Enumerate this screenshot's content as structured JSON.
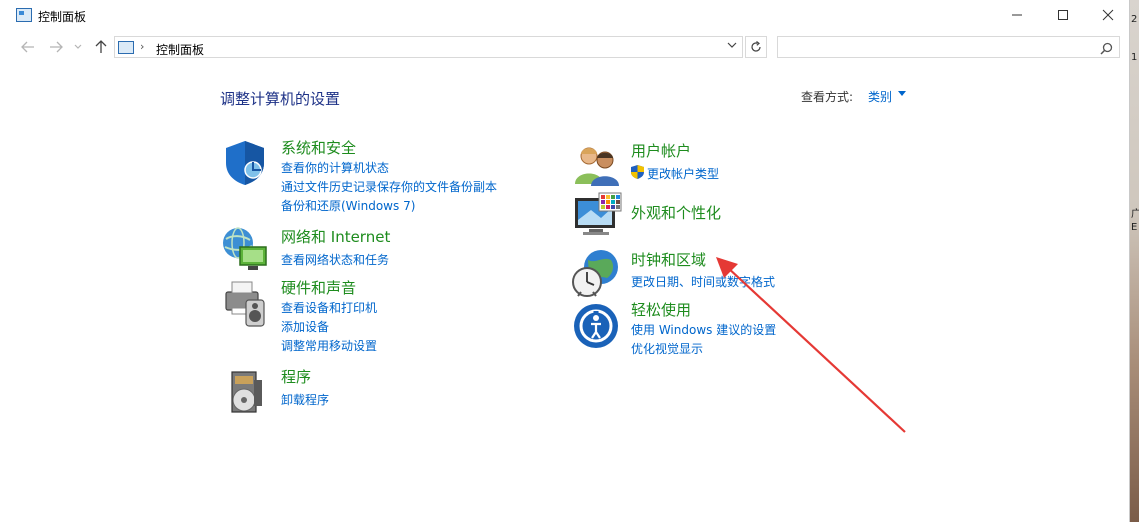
{
  "window": {
    "title": "控制面板",
    "minimize_glyph": "—",
    "maximize_glyph": "☐",
    "close_glyph": "✕"
  },
  "address": {
    "path": "控制面板",
    "separator": "›",
    "dropdown_glyph": "⌄",
    "search_placeholder": ""
  },
  "main": {
    "heading": "调整计算机的设置",
    "view_by_label": "查看方式:",
    "view_by_value": "类别"
  },
  "categories": [
    {
      "title": "系统和安全",
      "icon": "shield-icon",
      "links": [
        "查看你的计算机状态",
        "通过文件历史记录保存你的文件备份副本",
        "备份和还原(Windows 7)"
      ]
    },
    {
      "title": "网络和 Internet",
      "icon": "network-globe-icon",
      "links": [
        "查看网络状态和任务"
      ]
    },
    {
      "title": "硬件和声音",
      "icon": "printer-speaker-icon",
      "links": [
        "查看设备和打印机",
        "添加设备",
        "调整常用移动设置"
      ]
    },
    {
      "title": "程序",
      "icon": "programs-disc-icon",
      "links": [
        "卸载程序"
      ]
    },
    {
      "title": "用户帐户",
      "icon": "users-icon",
      "links": [
        "更改帐户类型"
      ]
    },
    {
      "title": "外观和个性化",
      "icon": "monitor-palette-icon",
      "links": []
    },
    {
      "title": "时钟和区域",
      "icon": "clock-globe-icon",
      "links": [
        "更改日期、时间或数字格式"
      ]
    },
    {
      "title": "轻松使用",
      "icon": "ease-of-access-icon",
      "links": [
        "使用 Windows 建议的设置",
        "优化视觉显示"
      ]
    }
  ],
  "desktop": {
    "right_edge_text": [
      "2",
      "1",
      "广",
      "E"
    ]
  },
  "colors": {
    "category_title": "#1e8c1e",
    "link": "#0066cc",
    "heading": "#1e3287",
    "annotation_arrow": "#e53935"
  }
}
